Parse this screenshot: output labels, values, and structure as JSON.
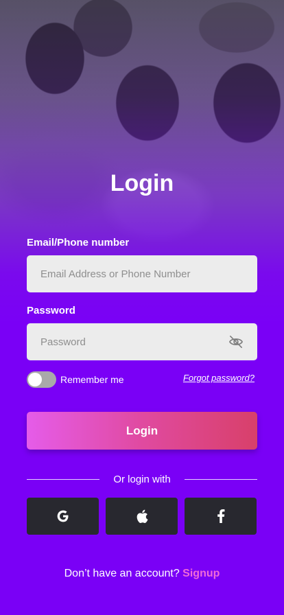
{
  "title": "Login",
  "email": {
    "label": "Email/Phone number",
    "placeholder": "Email Address or Phone Number",
    "value": ""
  },
  "password": {
    "label": "Password",
    "placeholder": "Password",
    "value": "",
    "toggle_icon": "eye-off-icon"
  },
  "remember": {
    "label": "Remember me",
    "enabled": false
  },
  "forgot_password": "Forgot password?",
  "login_button": "Login",
  "divider_text": "Or login with",
  "social": [
    {
      "name": "google",
      "icon": "google-icon"
    },
    {
      "name": "apple",
      "icon": "apple-icon"
    },
    {
      "name": "facebook",
      "icon": "facebook-icon"
    }
  ],
  "signup": {
    "prompt": "Don’t have an account?",
    "link": "Signup"
  },
  "colors": {
    "background": "#7a00f6",
    "button_gradient_start": "#e55ce9",
    "button_gradient_end": "#d8406a",
    "social_button": "#28282f",
    "signup_link": "#f06ad8"
  }
}
